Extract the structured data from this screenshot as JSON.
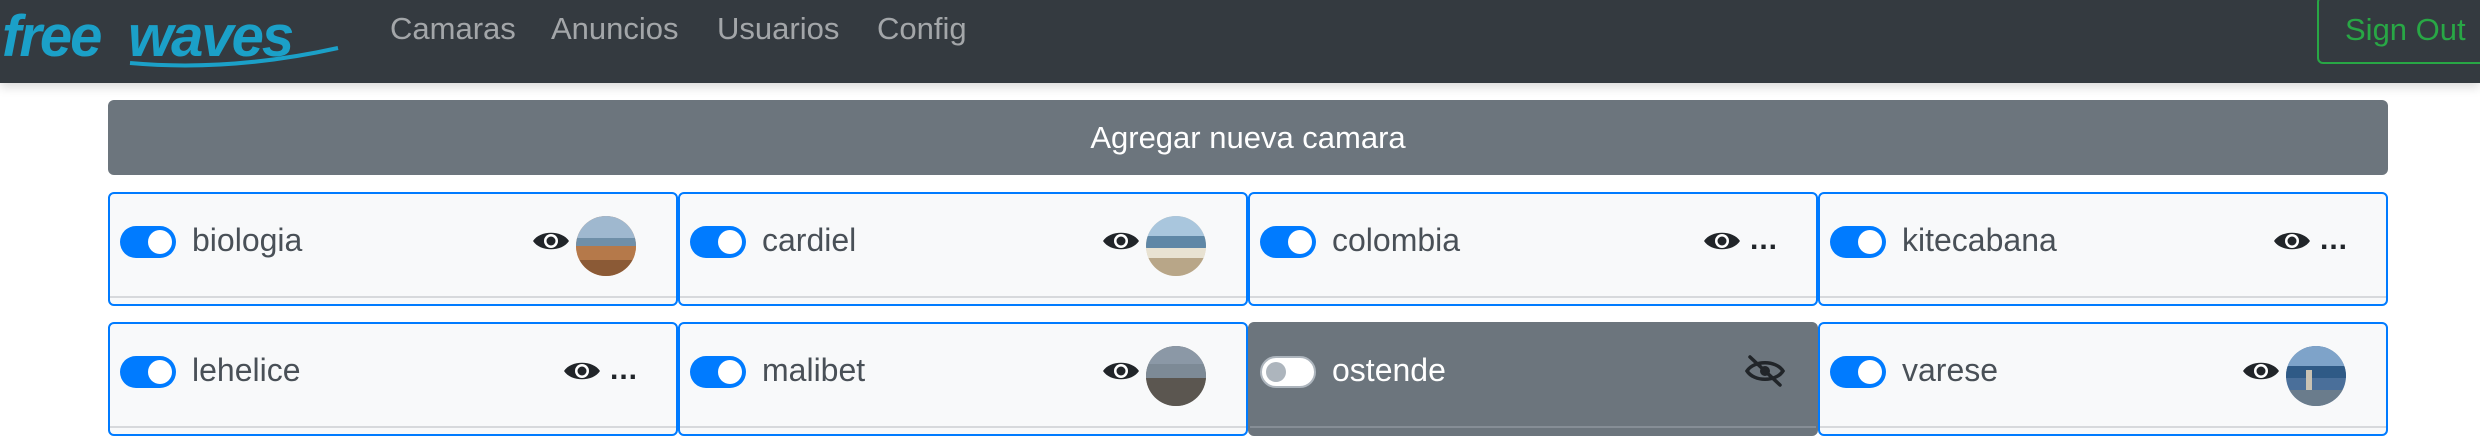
{
  "brand": {
    "logo_text": "free waves",
    "logo_color": "#1ba0c8"
  },
  "nav": {
    "items": [
      {
        "label": "Camaras"
      },
      {
        "label": "Anuncios"
      },
      {
        "label": "Usuarios"
      },
      {
        "label": "Config"
      }
    ],
    "signout_label": "Sign Out"
  },
  "add_button": {
    "label": "Agregar nueva camara"
  },
  "cameras": [
    {
      "name": "biologia",
      "enabled": true,
      "visible": true,
      "thumbnail": "beach-photo",
      "ellipsis": ""
    },
    {
      "name": "cardiel",
      "enabled": true,
      "visible": true,
      "thumbnail": "beach-photo",
      "ellipsis": ""
    },
    {
      "name": "colombia",
      "enabled": true,
      "visible": true,
      "thumbnail": "",
      "ellipsis": "..."
    },
    {
      "name": "kitecabana",
      "enabled": true,
      "visible": true,
      "thumbnail": "",
      "ellipsis": "..."
    },
    {
      "name": "lehelice",
      "enabled": true,
      "visible": true,
      "thumbnail": "",
      "ellipsis": "..."
    },
    {
      "name": "malibet",
      "enabled": true,
      "visible": true,
      "thumbnail": "beach-photo",
      "ellipsis": ""
    },
    {
      "name": "ostende",
      "enabled": false,
      "visible": false,
      "thumbnail": "",
      "ellipsis": ""
    },
    {
      "name": "varese",
      "enabled": true,
      "visible": true,
      "thumbnail": "beach-photo",
      "ellipsis": ""
    }
  ],
  "colors": {
    "navbar": "#343a40",
    "primary": "#007bff",
    "secondary": "#6c757d",
    "success": "#28a745",
    "card_bg": "#f8f9fa"
  }
}
